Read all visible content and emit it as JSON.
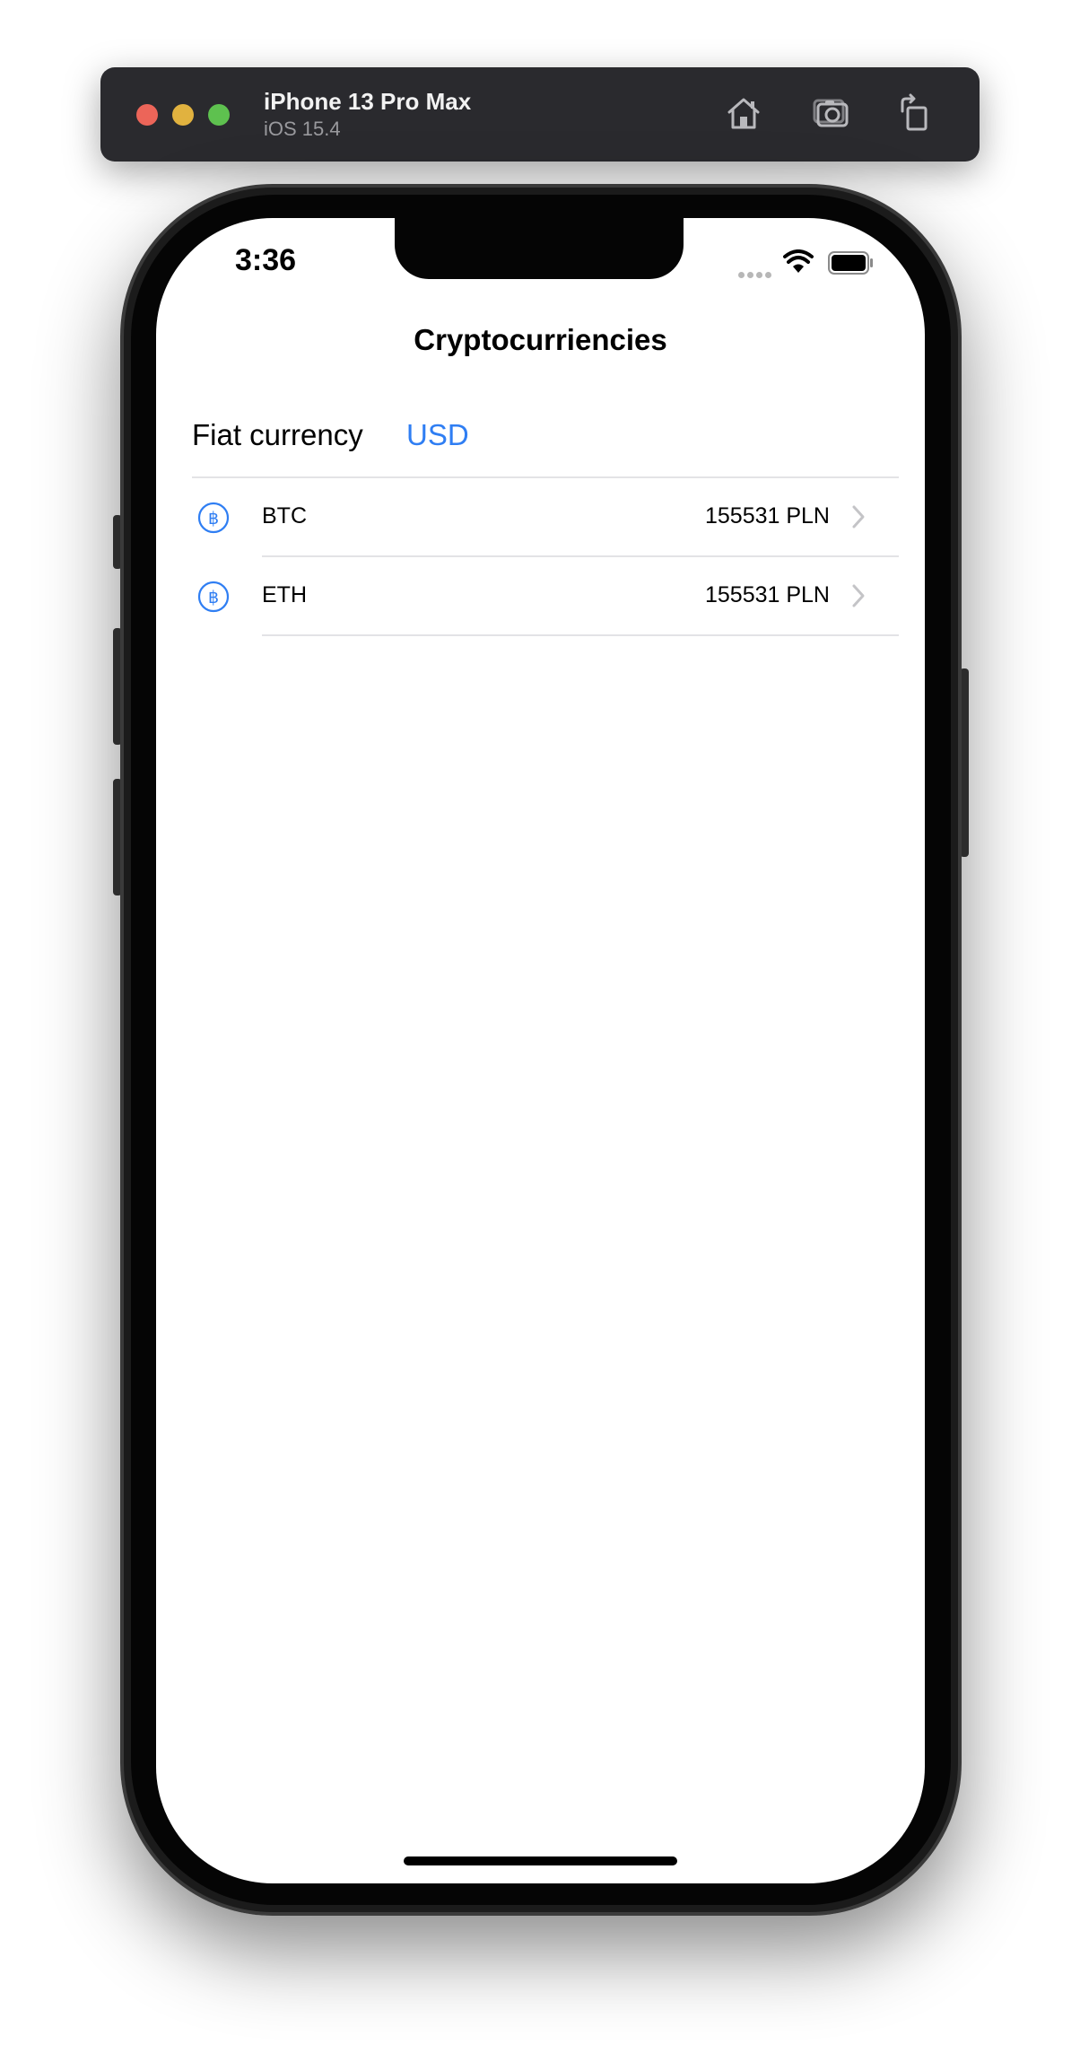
{
  "simulator": {
    "device_name": "iPhone 13 Pro Max",
    "os_version": "iOS 15.4",
    "icons": [
      "home-icon",
      "screenshot-icon",
      "rotate-icon"
    ]
  },
  "status_bar": {
    "time": "3:36",
    "icons": [
      "cellular-icon",
      "wifi-icon",
      "battery-icon"
    ]
  },
  "nav": {
    "title": "Cryptocurriencies"
  },
  "fiat": {
    "label": "Fiat currency",
    "value": "USD"
  },
  "list": {
    "items": [
      {
        "symbol": "BTC",
        "value": "155531 PLN",
        "icon": "bitcoin-icon"
      },
      {
        "symbol": "ETH",
        "value": "155531 PLN",
        "icon": "bitcoin-icon"
      }
    ]
  },
  "colors": {
    "accent": "#2f7ef3",
    "separator": "#e3e3e6",
    "chevron": "#c4c4c7"
  }
}
